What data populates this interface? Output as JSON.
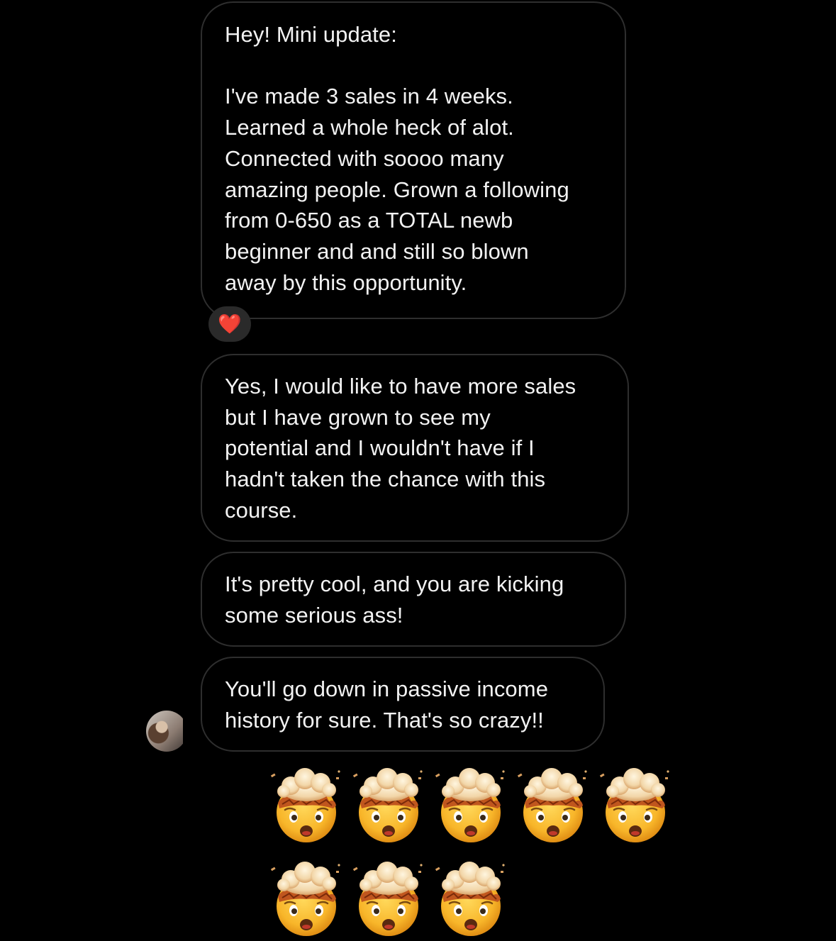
{
  "messages": [
    {
      "text": "Hey! Mini update:\n\nI've made 3 sales in 4 weeks.\nLearned a whole heck of alot.\nConnected with soooo many\namazing people. Grown a following\nfrom 0-650 as a TOTAL newb\nbeginner and and still so blown\naway by this opportunity.",
      "reaction": "❤️"
    },
    {
      "text": "Yes, I would like to have more sales\nbut I have grown to see my\npotential and I wouldn't have if I\nhadn't taken the chance with this\ncourse."
    },
    {
      "text": "It's pretty cool, and you are kicking\nsome serious ass!"
    },
    {
      "text": "You'll go down in passive income\nhistory for sure. That's so crazy!!"
    }
  ],
  "emoji_message": {
    "emoji": "exploding-head",
    "count": 8,
    "rows": [
      5,
      3
    ]
  },
  "colors": {
    "background": "#000000",
    "bubble_border": "#2e2e2e",
    "text": "#f2f2f2",
    "reaction_bg": "#2a2a2a"
  }
}
